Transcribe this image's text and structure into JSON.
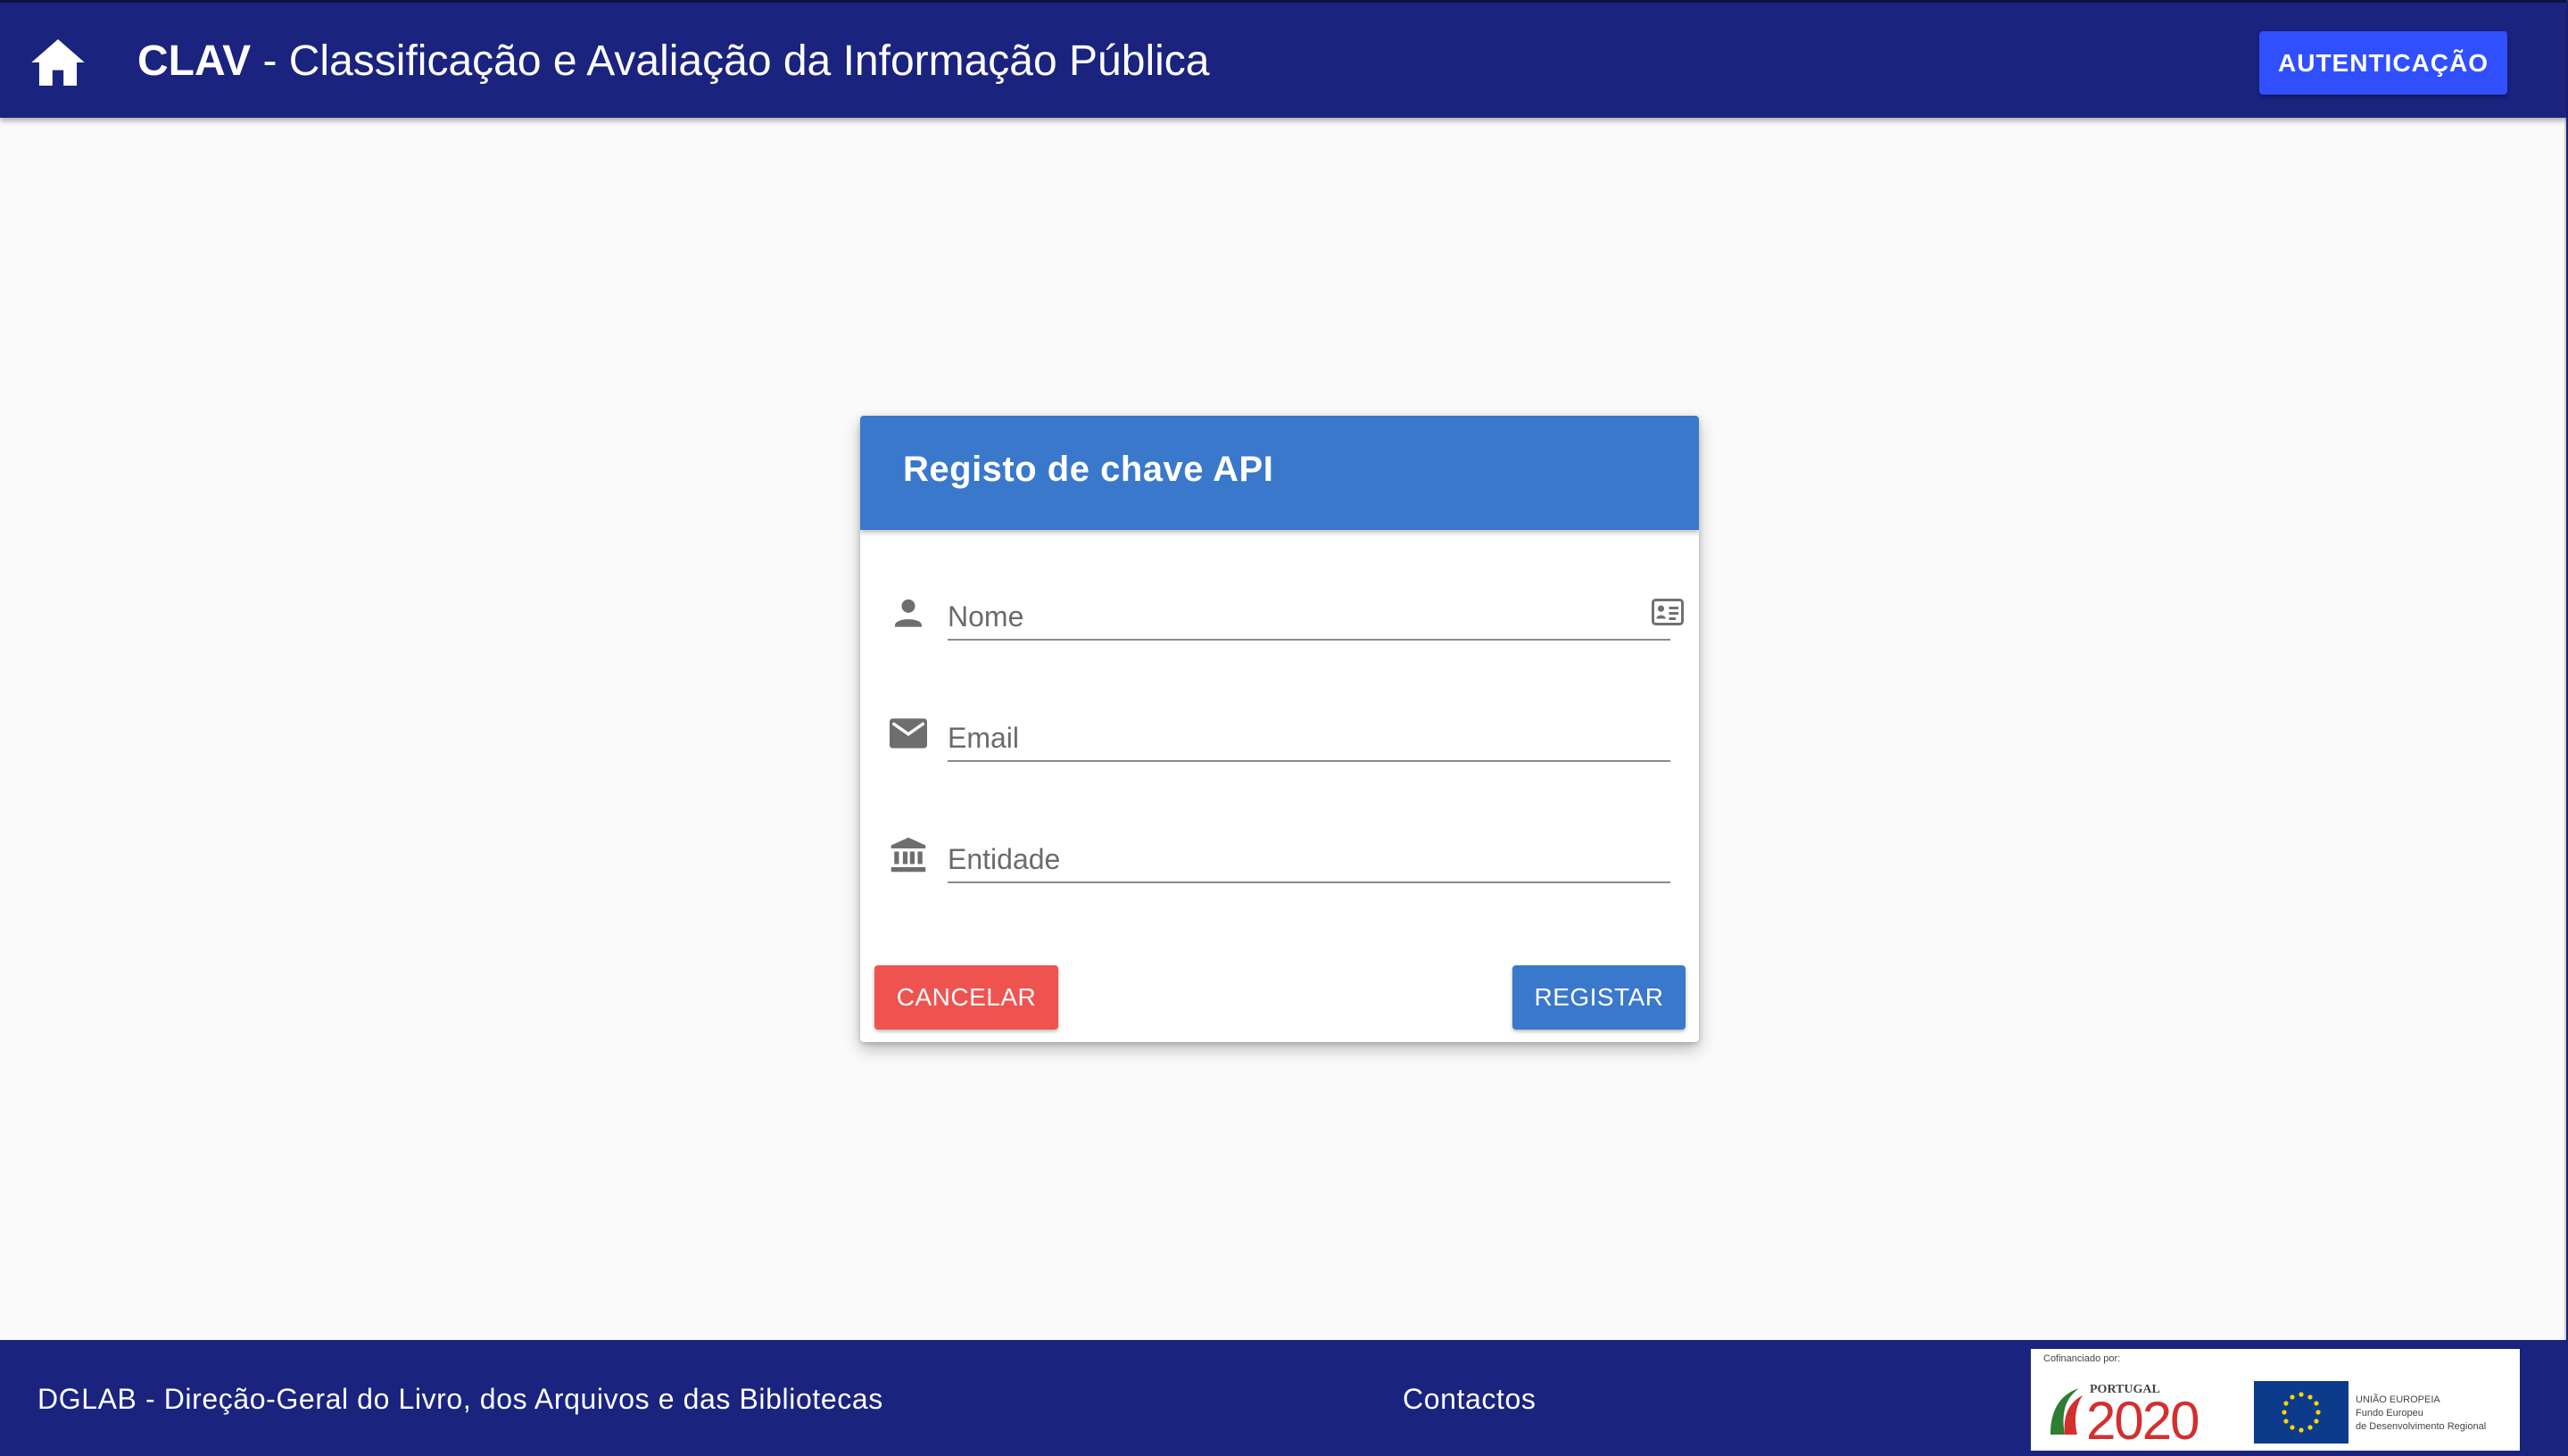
{
  "header": {
    "brand": "CLAV",
    "separator": " - ",
    "subtitle": "Classificação e Avaliação da Informação Pública",
    "auth_button": "AUTENTICAÇÃO"
  },
  "dialog": {
    "title": "Registo de chave API",
    "fields": [
      {
        "placeholder": "Nome",
        "value": ""
      },
      {
        "placeholder": "Email",
        "value": ""
      },
      {
        "placeholder": "Entidade",
        "value": ""
      }
    ],
    "cancel_button": "CANCELAR",
    "register_button": "REGISTAR"
  },
  "footer": {
    "organization": "DGLAB - Direção-Geral do Livro, dos Arquivos e das Bibliotecas",
    "contacts": "Contactos",
    "funding": {
      "cofinanced_by": "Cofinanciado por:",
      "program_label": "PORTUGAL",
      "program_year": "2020",
      "eu_line1": "UNIÃO EUROPEIA",
      "eu_line2": "Fundo Europeu",
      "eu_line3": "de Desenvolvimento Regional"
    }
  },
  "colors": {
    "primary": "#1a237e",
    "accent": "#304ffe",
    "card_header": "#3a78cc",
    "danger": "#ef5350"
  },
  "icons": {
    "home": "home-icon",
    "name": "person-icon",
    "name_trailing": "contact-card-icon",
    "email": "email-icon",
    "entity": "institution-icon"
  }
}
